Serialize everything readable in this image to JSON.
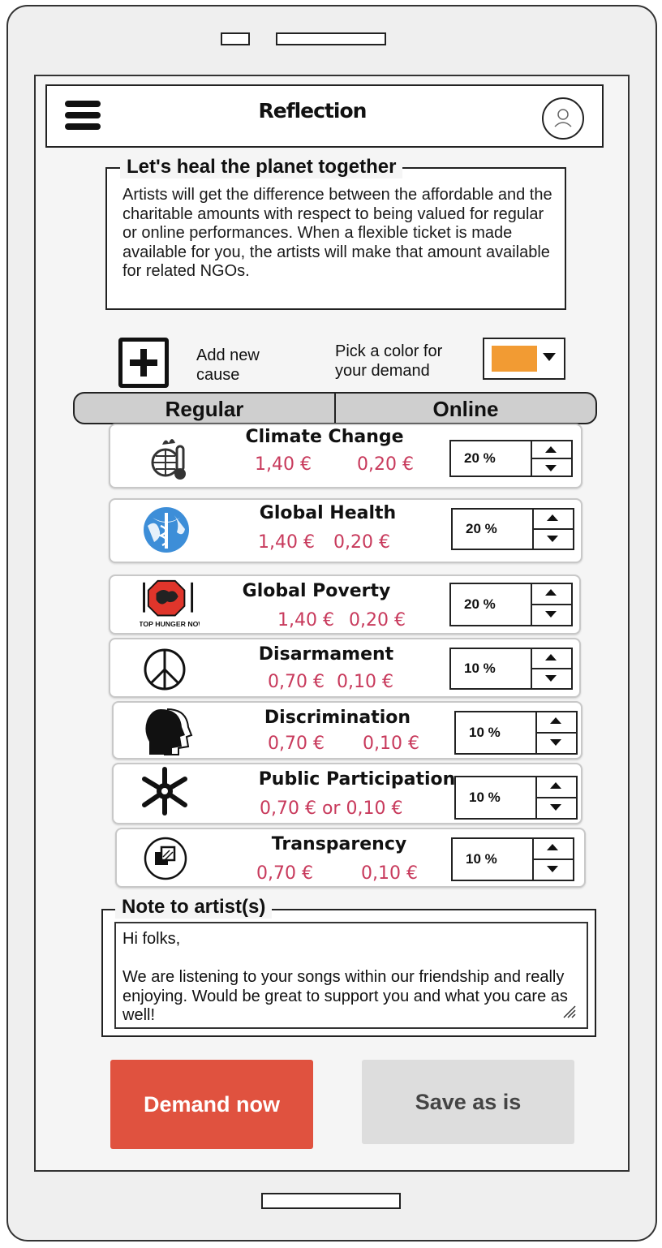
{
  "header": {
    "title": "Reflection"
  },
  "intro": {
    "title": "Let's heal the planet  together",
    "text": "Artists will get the difference between the affordable and the charitable amounts with respect to being valued for regular or online performances. When a flexible ticket is made available for you, the artists will make that amount available for related NGOs."
  },
  "actions": {
    "add_label": "Add new cause",
    "color_label": "Pick a color for your demand",
    "color_value": "#f29b33"
  },
  "tabs": {
    "regular": "Regular",
    "online": "Online"
  },
  "causes": [
    {
      "name": "Climate Change",
      "regular": "1,40 €",
      "online": "0,20 €",
      "percent": "20 %",
      "icon": "climate-thermometer-icon"
    },
    {
      "name": "Global Health",
      "regular": "1,40 €",
      "online": "0,20 €",
      "percent": "20 %",
      "icon": "globe-caduceus-icon"
    },
    {
      "name": "Global Poverty",
      "regular": "1,40 €",
      "online": "0,20 €",
      "percent": "20 %",
      "icon": "stop-hunger-now-icon",
      "icon_text": "STOP HUNGER NOW"
    },
    {
      "name": "Disarmament",
      "regular": "0,70 €",
      "online": "0,10 €",
      "percent": "10 %",
      "icon": "peace-icon"
    },
    {
      "name": "Discrimination",
      "regular": "0,70 €",
      "online": "0,10 €",
      "percent": "10 %",
      "icon": "heads-icon"
    },
    {
      "name": "Public Participation",
      "price_line": "0,70 € or 0,10 €",
      "percent": "10 %",
      "icon": "hands-icon"
    },
    {
      "name": "Transparency",
      "regular": "0,70 €",
      "online": "0,10 €",
      "percent": "10 %",
      "icon": "transparency-icon"
    }
  ],
  "note": {
    "title": "Note to artist(s)",
    "text": "Hi folks,\n\nWe are listening to your songs within our friendship and really enjoying. Would be great to support you and what you care as well!"
  },
  "buttons": {
    "demand": "Demand now",
    "save": "Save as is"
  }
}
